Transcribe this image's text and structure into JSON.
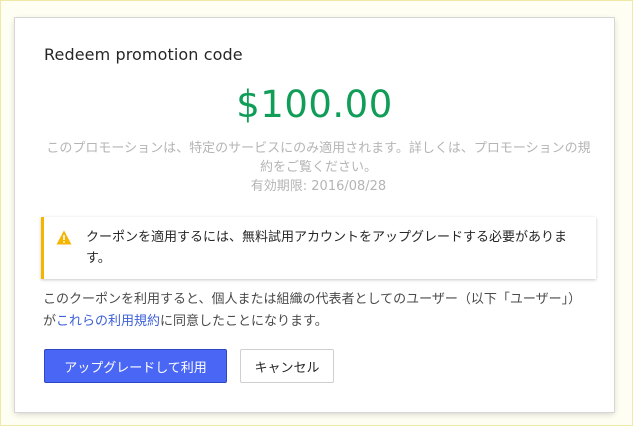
{
  "dialog": {
    "title": "Redeem promotion code",
    "amount": "$100.00",
    "description": "このプロモーションは、特定のサービスにのみ適用されます。詳しくは、プロモーションの規約をご覧ください。",
    "expiry": "有効期限: 2016/08/28",
    "warning": {
      "icon": "warning-icon",
      "text": "クーポンを適用するには、無料試用アカウントをアップグレードする必要があります。"
    },
    "terms": {
      "before": "このクーポンを利用すると、個人または組織の代表者としてのユーザー（以下「ユーザー」）が",
      "link": "これらの利用規約",
      "after": "に同意したことになります。"
    },
    "buttons": {
      "primary": "アップグレードして利用",
      "secondary": "キャンセル"
    }
  },
  "colors": {
    "amount": "#0f9d58",
    "warning_accent": "#f4b400",
    "primary_button": "#4a66f5",
    "link": "#3b5fd8"
  }
}
